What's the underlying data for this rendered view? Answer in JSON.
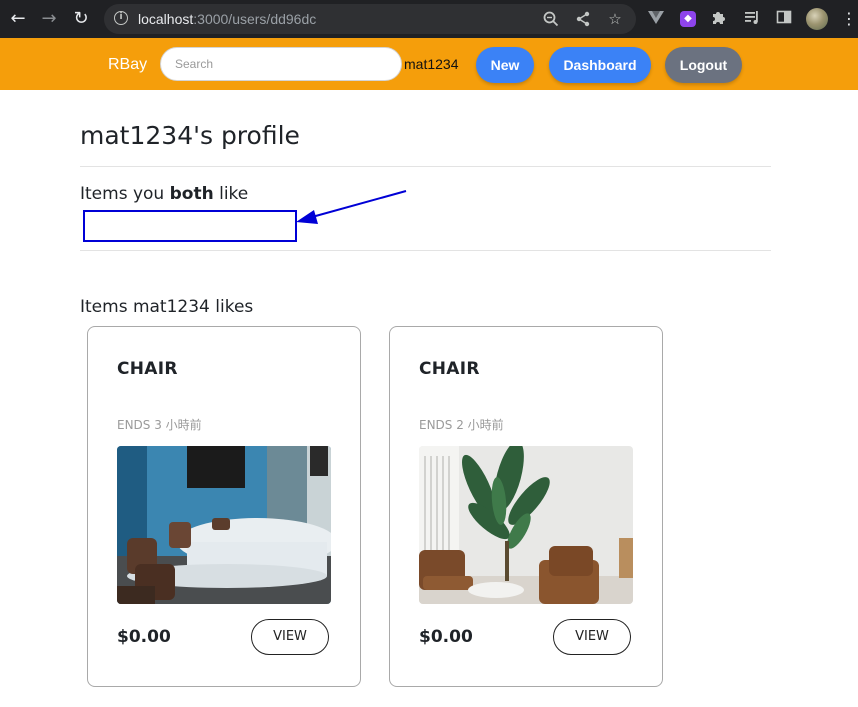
{
  "browser": {
    "url_host": "localhost",
    "url_path": ":3000/users/dd96dc"
  },
  "header": {
    "brand": "RBay",
    "search_placeholder": "Search",
    "username": "mat1234",
    "new_label": "New",
    "dashboard_label": "Dashboard",
    "logout_label": "Logout",
    "color": "#f59e0b"
  },
  "profile": {
    "title": "mat1234's profile",
    "both_like_prefix": "Items you ",
    "both_like_bold": "both",
    "both_like_suffix": " like",
    "user_likes_label": "Items mat1234 likes"
  },
  "items": [
    {
      "name": "CHAIR",
      "ends": "ENDS 3 小時前",
      "price": "$0.00",
      "view_label": "VIEW",
      "image": "meeting-room-chairs-image"
    },
    {
      "name": "CHAIR",
      "ends": "ENDS 2 小時前",
      "price": "$0.00",
      "view_label": "VIEW",
      "image": "plant-and-armchairs-image"
    }
  ],
  "annotation": {
    "color": "#0000d6"
  }
}
